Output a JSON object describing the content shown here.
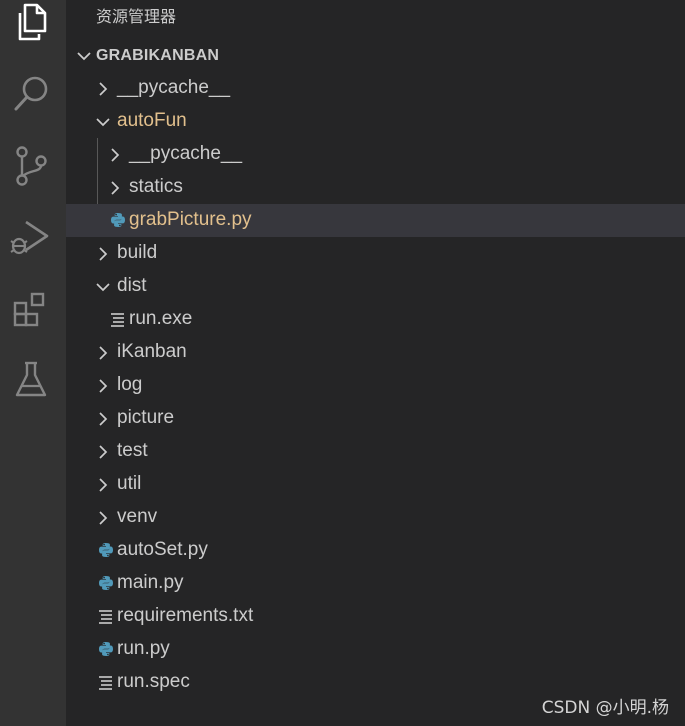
{
  "explorer": {
    "title": "资源管理器",
    "root": "GRABIKANBAN",
    "items": [
      {
        "label": "__pycache__",
        "type": "folder",
        "expanded": false,
        "depth": 0
      },
      {
        "label": "autoFun",
        "type": "folder",
        "expanded": true,
        "depth": 0,
        "modified": true
      },
      {
        "label": "__pycache__",
        "type": "folder",
        "expanded": false,
        "depth": 1
      },
      {
        "label": "statics",
        "type": "folder",
        "expanded": false,
        "depth": 1
      },
      {
        "label": "grabPicture.py",
        "type": "python",
        "depth": 1,
        "modified": true,
        "selected": true
      },
      {
        "label": "build",
        "type": "folder",
        "expanded": false,
        "depth": 0
      },
      {
        "label": "dist",
        "type": "folder",
        "expanded": true,
        "depth": 0
      },
      {
        "label": "run.exe",
        "type": "text",
        "depth": 1
      },
      {
        "label": "iKanban",
        "type": "folder",
        "expanded": false,
        "depth": 0
      },
      {
        "label": "log",
        "type": "folder",
        "expanded": false,
        "depth": 0
      },
      {
        "label": "picture",
        "type": "folder",
        "expanded": false,
        "depth": 0
      },
      {
        "label": "test",
        "type": "folder",
        "expanded": false,
        "depth": 0
      },
      {
        "label": "util",
        "type": "folder",
        "expanded": false,
        "depth": 0
      },
      {
        "label": "venv",
        "type": "folder",
        "expanded": false,
        "depth": 0
      },
      {
        "label": "autoSet.py",
        "type": "python",
        "depth": 0
      },
      {
        "label": "main.py",
        "type": "python",
        "depth": 0
      },
      {
        "label": "requirements.txt",
        "type": "text",
        "depth": 0
      },
      {
        "label": "run.py",
        "type": "python",
        "depth": 0
      },
      {
        "label": "run.spec",
        "type": "text",
        "depth": 0
      }
    ]
  },
  "activity_bar": {
    "icons": [
      "explorer-icon",
      "search-icon",
      "source-control-icon",
      "run-debug-icon",
      "extensions-icon",
      "testing-icon"
    ]
  },
  "colors": {
    "activity_bar": "#333333",
    "sidebar": "#252526",
    "selected_row": "#37373d",
    "text": "#cccccc",
    "modified_text": "#e2c08d",
    "python_icon": "#519aba"
  },
  "watermark": "CSDN @小明.杨"
}
